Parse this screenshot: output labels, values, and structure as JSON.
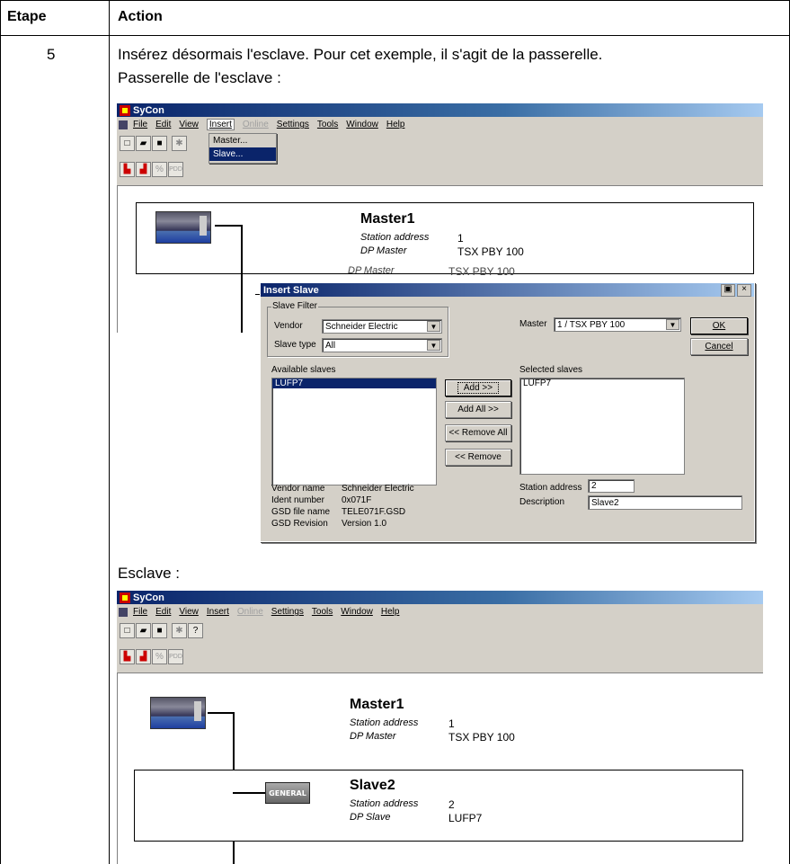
{
  "table": {
    "col_step": "Etape",
    "col_action": "Action",
    "step": "5",
    "intro_line1": "Insérez désormais l'esclave. Pour cet exemple, il s'agit de la passerelle.",
    "intro_line2": "Passerelle de l'esclave :",
    "section2": "Esclave :"
  },
  "app": {
    "title": "SyCon",
    "menu": [
      "File",
      "Edit",
      "View",
      "Insert",
      "Online",
      "Settings",
      "Tools",
      "Window",
      "Help"
    ],
    "insert_menu": [
      "Master...",
      "Slave..."
    ],
    "toolbar_pdd": "PDD"
  },
  "master": {
    "title": "Master1",
    "station_label": "Station address",
    "station_value": "1",
    "type_label": "DP Master",
    "type_value": "TSX PBY 100",
    "overlap_left": "DP Master",
    "overlap_right": "TSX PBY 100"
  },
  "dialog": {
    "title": "Insert Slave",
    "group_label": "Slave Filter",
    "vendor_label": "Vendor",
    "vendor_value": "Schneider Electric",
    "slavetype_label": "Slave type",
    "slavetype_value": "All",
    "master_label": "Master",
    "master_value": "1 / TSX PBY 100",
    "ok": "OK",
    "cancel": "Cancel",
    "available_label": "Available slaves",
    "available_items": [
      "LUFP7"
    ],
    "selected_label": "Selected slaves",
    "selected_items": [
      "LUFP7"
    ],
    "add": "Add >>",
    "add_all": "Add All >>",
    "remove_all": "<< Remove All",
    "remove": "<< Remove",
    "vendor_name_label": "Vendor name",
    "vendor_name_value": "Schneider Electric",
    "ident_label": "Ident number",
    "ident_value": "0x071F",
    "gsd_file_label": "GSD file name",
    "gsd_file_value": "TELE071F.GSD",
    "gsd_rev_label": "GSD Revision",
    "gsd_rev_value": "Version 1.0",
    "station_label": "Station address",
    "station_value": "2",
    "desc_label": "Description",
    "desc_value": "Slave2"
  },
  "slave": {
    "title": "Slave2",
    "station_label": "Station address",
    "station_value": "2",
    "type_label": "DP Slave",
    "type_value": "LUFP7",
    "icon_text": "GENERAL"
  }
}
